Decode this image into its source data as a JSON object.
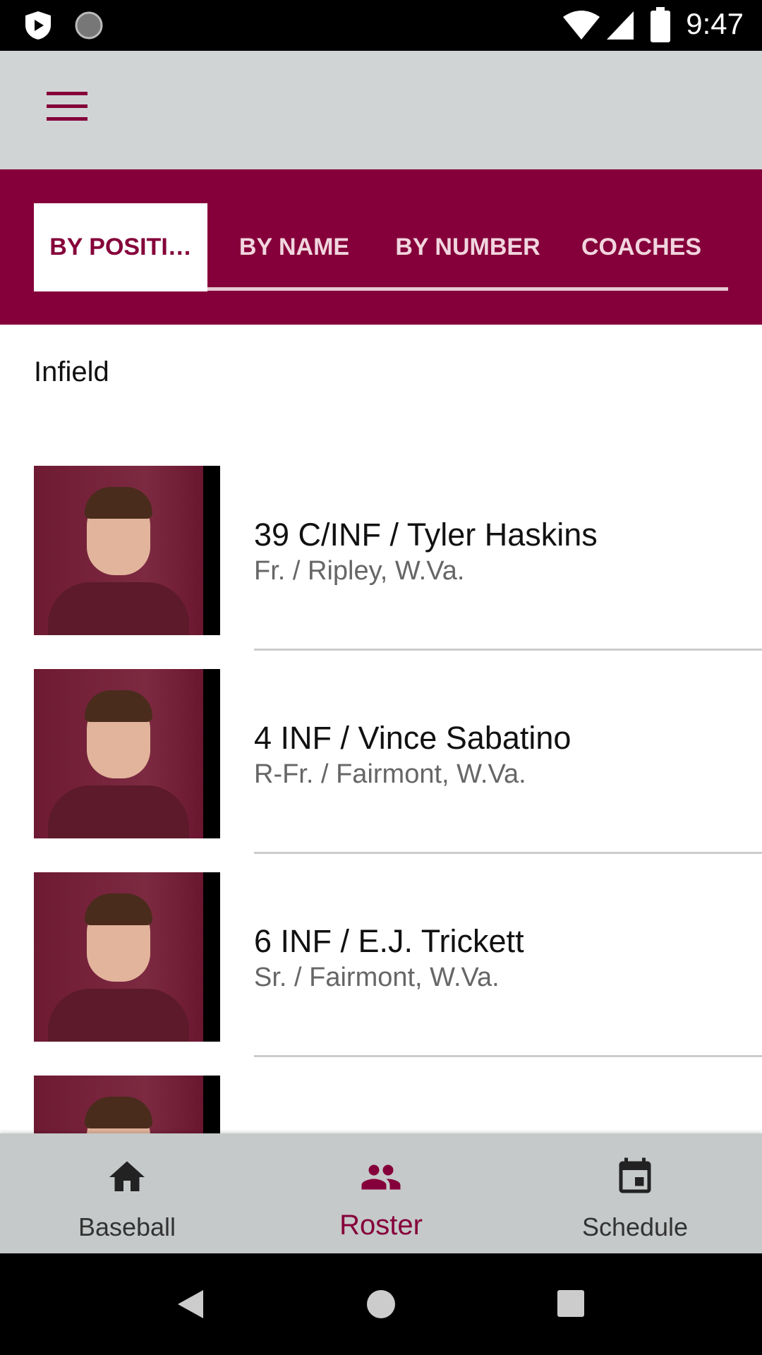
{
  "status_bar": {
    "time": "9:47"
  },
  "tabs": [
    {
      "label": "BY POSITI…",
      "selected": true
    },
    {
      "label": "BY NAME"
    },
    {
      "label": "BY NUMBER"
    },
    {
      "label": "COACHES"
    }
  ],
  "section": "Infield",
  "players": [
    {
      "title": "39 C/INF / Tyler Haskins",
      "subtitle": "Fr. / Ripley, W.Va."
    },
    {
      "title": "4 INF / Vince Sabatino",
      "subtitle": "R-Fr. / Fairmont, W.Va."
    },
    {
      "title": "6 INF / E.J. Trickett",
      "subtitle": "Sr. / Fairmont, W.Va."
    }
  ],
  "bottom_nav": [
    {
      "label": "Baseball",
      "icon": "home-icon"
    },
    {
      "label": "Roster",
      "icon": "people-icon",
      "active": true
    },
    {
      "label": "Schedule",
      "icon": "calendar-icon"
    }
  ],
  "colors": {
    "accent": "#85003a",
    "header": "#d1d4d5",
    "bottom_nav": "#c5c9c9"
  }
}
